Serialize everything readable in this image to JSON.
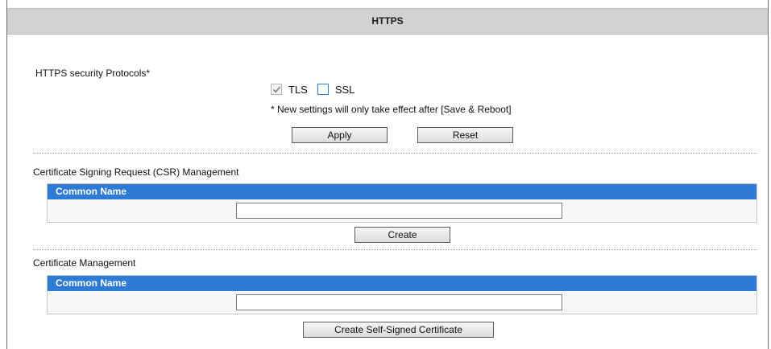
{
  "header": {
    "title": "HTTPS"
  },
  "protocols": {
    "label": "HTTPS security Protocols*",
    "tls": {
      "label": "TLS",
      "checked": true,
      "disabled": true
    },
    "ssl": {
      "label": "SSL",
      "checked": false
    },
    "note": "* New settings will only take effect after [Save & Reboot]",
    "apply_label": "Apply",
    "reset_label": "Reset"
  },
  "csr": {
    "section_label": "Certificate Signing Request (CSR) Management",
    "column_header": "Common Name",
    "common_name_value": "",
    "create_label": "Create"
  },
  "cert": {
    "section_label": "Certificate Management",
    "column_header": "Common Name",
    "common_name_value": "",
    "create_self_signed_label": "Create Self-Signed Certificate"
  },
  "colors": {
    "header_bg": "#d2d2d2",
    "table_header_bg": "#2e7bd6",
    "checkbox_accent": "#2b7bd0"
  }
}
